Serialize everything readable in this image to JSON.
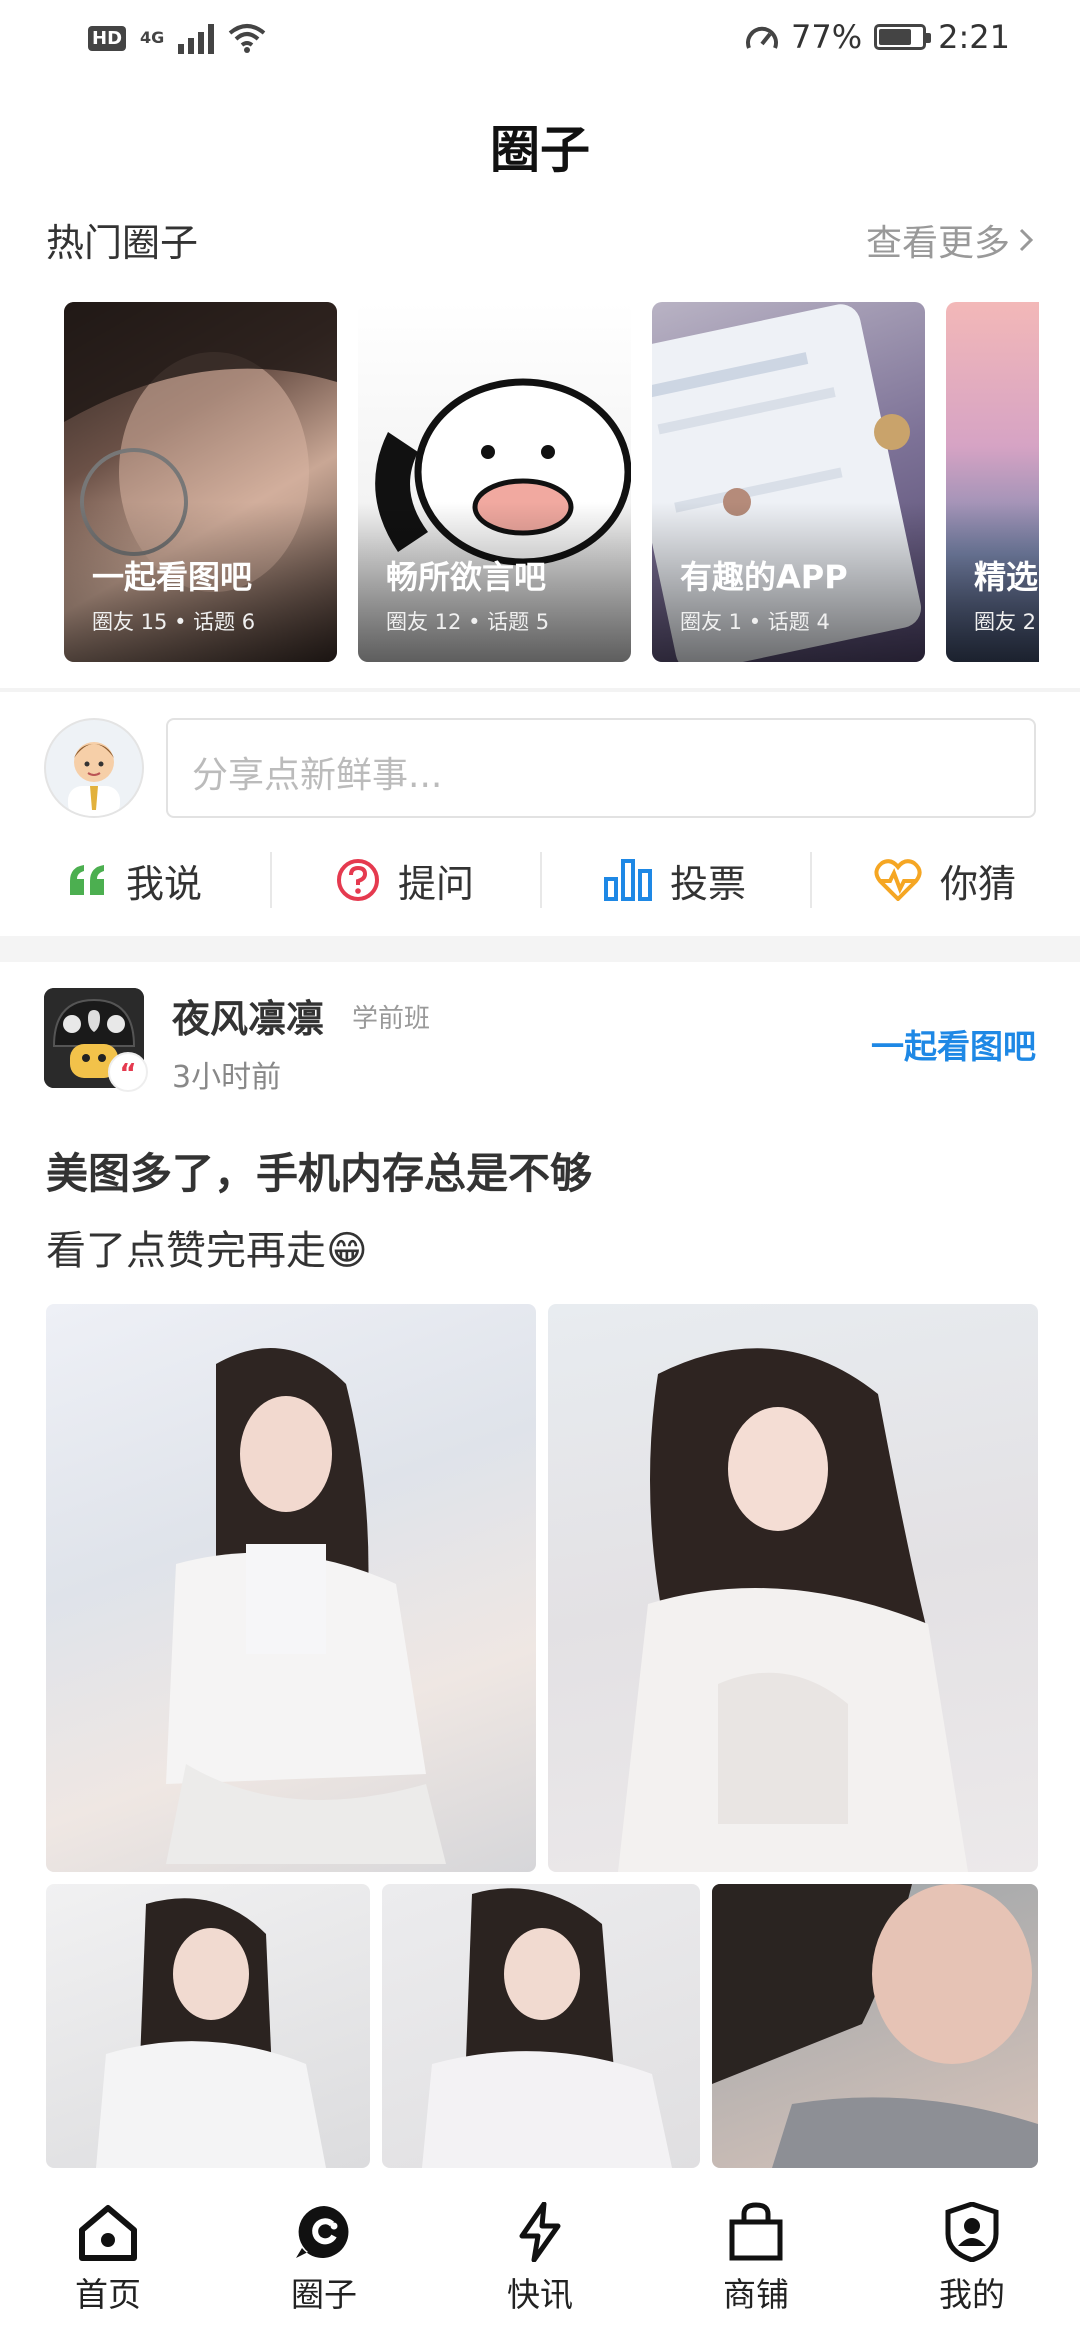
{
  "status_bar": {
    "hd": "HD",
    "network": "4G",
    "battery_percent": "77%",
    "battery_level": 0.77,
    "time": "2:21"
  },
  "page_title": "圈子",
  "hot": {
    "title": "热门圈子",
    "see_more": "查看更多",
    "cards": [
      {
        "name": "一起看图吧",
        "stats": "圈友 15 • 话题 6"
      },
      {
        "name": "畅所欲言吧",
        "stats": "圈友 12 • 话题 5"
      },
      {
        "name": "有趣的APP",
        "stats": "圈友 1 • 话题 4"
      },
      {
        "name": "精选",
        "stats": "圈友 2"
      }
    ]
  },
  "composer": {
    "placeholder": "分享点新鲜事..."
  },
  "actions": [
    {
      "label": "我说",
      "icon": "quote-icon",
      "color": "#4caf50"
    },
    {
      "label": "提问",
      "icon": "question-icon",
      "color": "#e53a4f"
    },
    {
      "label": "投票",
      "icon": "bar-chart-icon",
      "color": "#1e88e5"
    },
    {
      "label": "你猜",
      "icon": "heart-pulse-icon",
      "color": "#f5a623"
    }
  ],
  "post": {
    "username": "夜风凛凛",
    "level": "学前班",
    "time": "3小时前",
    "circle": "一起看图吧",
    "title": "美图多了，手机内存总是不够",
    "body": "看了点赞完再走😁"
  },
  "tabs": [
    {
      "label": "首页",
      "icon": "home-icon"
    },
    {
      "label": "圈子",
      "icon": "circle-chat-icon"
    },
    {
      "label": "快讯",
      "icon": "lightning-icon"
    },
    {
      "label": "商铺",
      "icon": "shopping-bag-icon"
    },
    {
      "label": "我的",
      "icon": "user-shield-icon"
    }
  ],
  "colors": {
    "accent_blue": "#1e88e5",
    "green": "#4caf50",
    "red": "#e53a4f",
    "orange": "#f5a623"
  }
}
